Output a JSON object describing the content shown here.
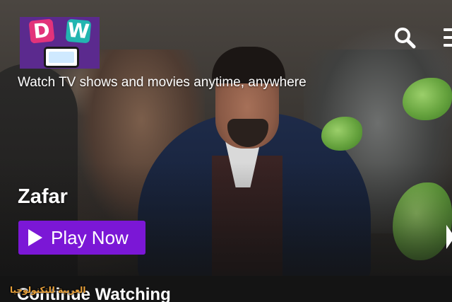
{
  "header": {
    "logo_letters": [
      "D",
      "W"
    ],
    "tagline": "Watch TV shows and movies anytime, anywhere",
    "search_icon": "search-icon",
    "menu_icon": "hamburger-menu-icon"
  },
  "hero": {
    "title": "Zafar",
    "play_label": "Play Now",
    "play_icon": "play-icon",
    "next_icon": "chevron-right-icon"
  },
  "sections": {
    "continue_title": "Continue Watching"
  },
  "watermark": {
    "text": "العربية للتكنولوجيا"
  },
  "colors": {
    "accent": "#7b17d6",
    "logo_bg": "#5b2a8e",
    "logo_d": "#e2337a",
    "logo_w": "#22b5b0",
    "background": "#141414",
    "text": "#ffffff"
  }
}
